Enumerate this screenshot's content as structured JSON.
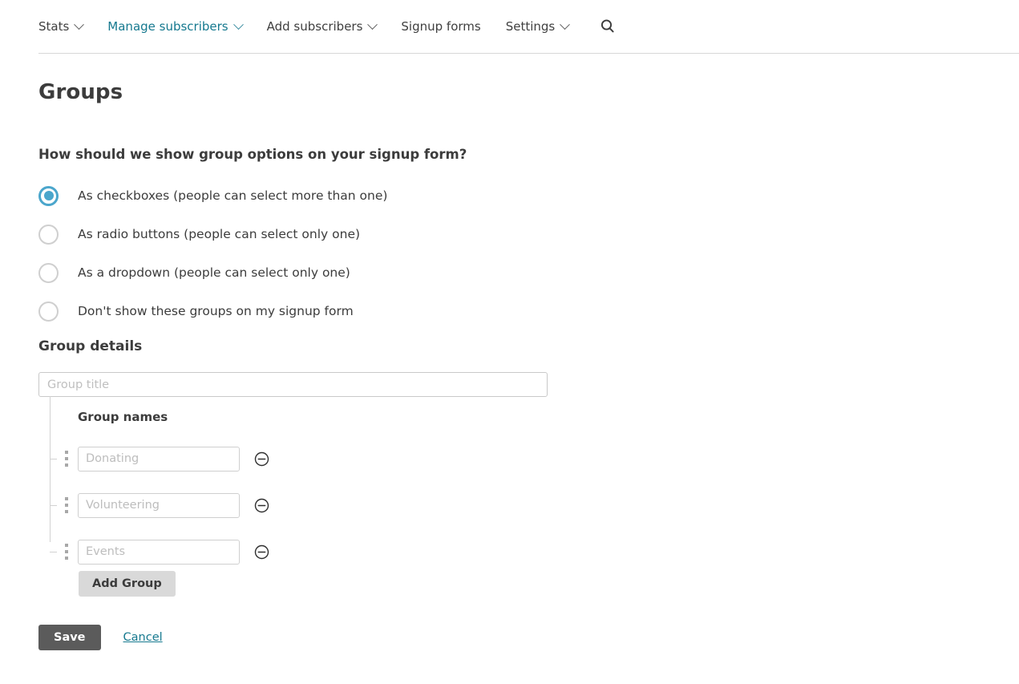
{
  "nav": {
    "items": [
      {
        "label": "Stats",
        "has_chevron": true,
        "active": false,
        "icon": "chevron-down-icon"
      },
      {
        "label": "Manage subscribers",
        "has_chevron": true,
        "active": true,
        "icon": "chevron-down-icon"
      },
      {
        "label": "Add subscribers",
        "has_chevron": true,
        "active": false,
        "icon": "chevron-down-icon"
      },
      {
        "label": "Signup forms",
        "has_chevron": false,
        "active": false,
        "icon": ""
      },
      {
        "label": "Settings",
        "has_chevron": true,
        "active": false,
        "icon": "chevron-down-icon"
      }
    ],
    "search_icon": "search-icon"
  },
  "page": {
    "title": "Groups",
    "question": "How should we show group options on your signup form?"
  },
  "radio_options": [
    {
      "label": "As checkboxes (people can select more than one)",
      "selected": true
    },
    {
      "label": "As radio buttons (people can select only one)",
      "selected": false
    },
    {
      "label": "As a dropdown (people can select only one)",
      "selected": false
    },
    {
      "label": "Don't show these groups on my signup form",
      "selected": false
    }
  ],
  "group_details": {
    "section_title": "Group details",
    "group_title": {
      "value": "",
      "placeholder": "Group title"
    },
    "names_label": "Group names",
    "names": [
      {
        "value": "",
        "placeholder": "Donating",
        "remove_icon": "minus-circle-icon",
        "drag_icon": "drag-handle-icon"
      },
      {
        "value": "",
        "placeholder": "Volunteering",
        "remove_icon": "minus-circle-icon",
        "drag_icon": "drag-handle-icon"
      },
      {
        "value": "",
        "placeholder": "Events",
        "remove_icon": "minus-circle-icon",
        "drag_icon": "drag-handle-icon"
      }
    ],
    "add_group_label": "Add Group"
  },
  "footer": {
    "save_label": "Save",
    "cancel_label": "Cancel"
  },
  "colors": {
    "accent_teal": "#16798f",
    "radio_selected": "#4ba6cc",
    "save_button": "#5b5b5b",
    "add_button": "#d9d9d9",
    "text": "#3c3c3c",
    "border": "#c9c9c9"
  }
}
